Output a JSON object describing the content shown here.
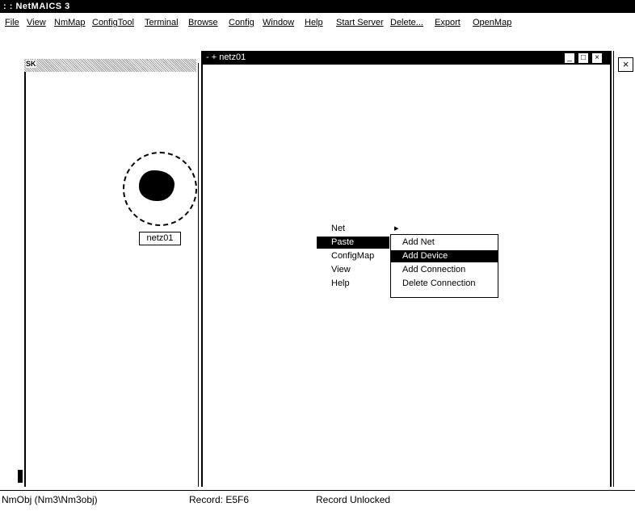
{
  "app": {
    "title": ": : NetMAICS 3"
  },
  "menu": {
    "items": [
      "File",
      "View",
      "NmMap",
      "ConfigTool",
      "Terminal",
      "Browse",
      "Config",
      "Window",
      "Help",
      "Start Server",
      "Delete...",
      "Export",
      "OpenMap"
    ]
  },
  "left_panel": {
    "header_text": "SK"
  },
  "node": {
    "label": "netz01"
  },
  "child_window": {
    "title": "- + netz01",
    "buttons": {
      "minimize": "_",
      "maximize": "□",
      "close": "×"
    }
  },
  "right_strip": {
    "close": "×"
  },
  "context_menu": {
    "items": [
      "Net",
      "Paste",
      "ConfigMap",
      "View",
      "Help"
    ],
    "submenu_indicator": "▸",
    "submenu": [
      "Add Net",
      "Add Device",
      "Add Connection",
      "Delete Connection"
    ]
  },
  "status": {
    "object": "NmObj (Nm3\\Nm3obj)",
    "record": "Record: E5F6",
    "lock": "Record Unlocked"
  },
  "colors": {
    "title_bg": "#000000",
    "title_fg": "#ffffff",
    "highlight": "#000000"
  }
}
